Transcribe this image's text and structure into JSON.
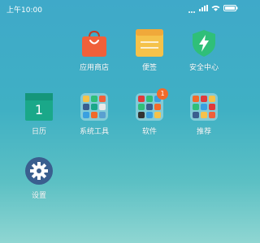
{
  "status_bar": {
    "time": "上午10:00"
  },
  "apps": [
    {
      "id": "store",
      "label": "应用商店"
    },
    {
      "id": "notes",
      "label": "便签"
    },
    {
      "id": "security",
      "label": "安全中心"
    },
    {
      "id": "calendar",
      "label": "日历",
      "date": "1"
    },
    {
      "id": "tools",
      "label": "系统工具"
    },
    {
      "id": "software",
      "label": "软件",
      "badge": "1"
    },
    {
      "id": "recommend",
      "label": "推荐"
    },
    {
      "id": "settings",
      "label": "设置"
    }
  ],
  "colors": {
    "store": "#f0603a",
    "notes": "#f5c24a",
    "security": "#2fbf79",
    "calendar": "#1aa889",
    "settings": "#3a5f8f",
    "badge": "#f26a2a"
  }
}
